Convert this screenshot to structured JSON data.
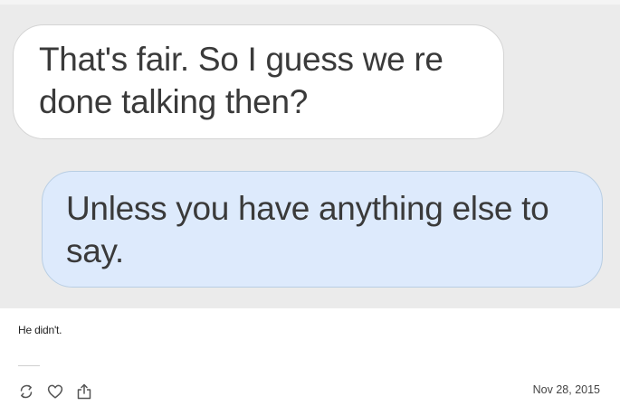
{
  "messages": [
    {
      "direction": "received",
      "text": "That's fair. So I guess we re done talking then?"
    },
    {
      "direction": "sent",
      "text": "Unless you have anything else to say."
    }
  ],
  "post": {
    "caption": "He didn't.",
    "date": "Nov 28, 2015"
  },
  "actions": [
    {
      "icon": "reblog-icon"
    },
    {
      "icon": "heart-icon"
    },
    {
      "icon": "share-icon"
    }
  ],
  "colors": {
    "background": "#ebebeb",
    "received_bubble": "#ffffff",
    "sent_bubble": "#ddeafc",
    "sent_border": "#b9cee3",
    "text": "#3a3a3a"
  }
}
